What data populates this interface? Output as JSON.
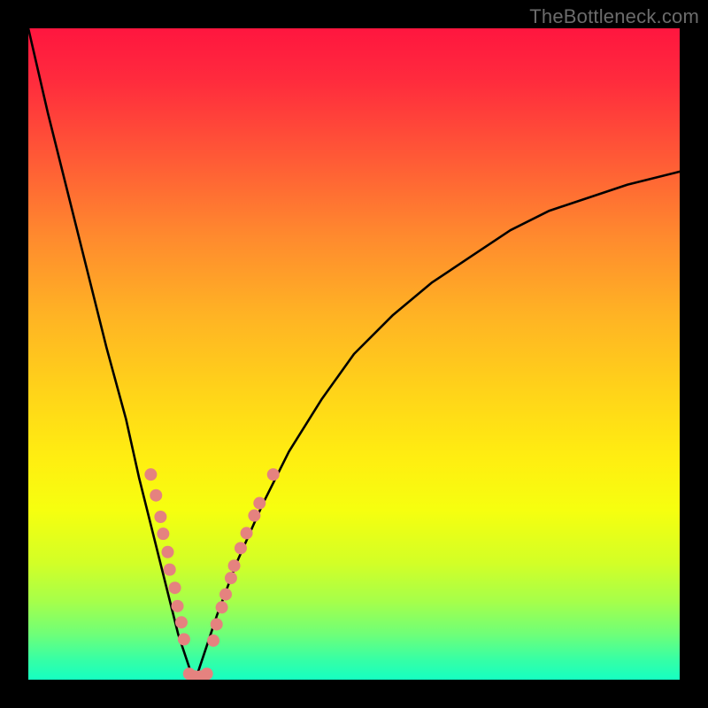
{
  "watermark": "TheBottleneck.com",
  "chart_data": {
    "type": "line",
    "title": "",
    "xlabel": "",
    "ylabel": "",
    "xlim": [
      0,
      100
    ],
    "ylim": [
      0,
      100
    ],
    "grid": false,
    "background": "rainbow-vertical-gradient",
    "series": [
      {
        "name": "bottleneck-curve",
        "color": "#000000",
        "x": [
          0,
          3,
          6,
          9,
          12,
          15,
          17,
          19,
          21,
          23,
          25,
          25.5,
          26,
          27,
          29,
          32,
          36,
          40,
          45,
          50,
          56,
          62,
          68,
          74,
          80,
          86,
          92,
          100
        ],
        "y": [
          100,
          87,
          75,
          63,
          51,
          40,
          31,
          23,
          15,
          7,
          1,
          0,
          1,
          4,
          10,
          18,
          27,
          35,
          43,
          50,
          56,
          61,
          65,
          69,
          72,
          74,
          76,
          78
        ]
      }
    ],
    "markers": [
      {
        "name": "dots-left",
        "color": "#e5827f",
        "radius": 7,
        "points": [
          {
            "x": 18.8,
            "y": 31.5
          },
          {
            "x": 19.6,
            "y": 28.3
          },
          {
            "x": 20.3,
            "y": 25.0
          },
          {
            "x": 20.7,
            "y": 22.4
          },
          {
            "x": 21.4,
            "y": 19.6
          },
          {
            "x": 21.7,
            "y": 16.9
          },
          {
            "x": 22.5,
            "y": 14.1
          },
          {
            "x": 22.9,
            "y": 11.3
          },
          {
            "x": 23.5,
            "y": 8.8
          },
          {
            "x": 23.9,
            "y": 6.2
          }
        ]
      },
      {
        "name": "dots-bottom",
        "color": "#e5827f",
        "radius": 7,
        "points": [
          {
            "x": 24.7,
            "y": 0.9
          },
          {
            "x": 25.6,
            "y": 0.5
          },
          {
            "x": 26.5,
            "y": 0.5
          },
          {
            "x": 27.4,
            "y": 0.9
          }
        ]
      },
      {
        "name": "dots-right",
        "color": "#e5827f",
        "radius": 7,
        "points": [
          {
            "x": 28.4,
            "y": 6.0
          },
          {
            "x": 28.9,
            "y": 8.5
          },
          {
            "x": 29.7,
            "y": 11.1
          },
          {
            "x": 30.3,
            "y": 13.1
          },
          {
            "x": 31.1,
            "y": 15.6
          },
          {
            "x": 31.6,
            "y": 17.5
          },
          {
            "x": 32.6,
            "y": 20.2
          },
          {
            "x": 33.5,
            "y": 22.5
          },
          {
            "x": 34.7,
            "y": 25.2
          },
          {
            "x": 35.5,
            "y": 27.1
          },
          {
            "x": 37.6,
            "y": 31.5
          }
        ]
      }
    ]
  }
}
